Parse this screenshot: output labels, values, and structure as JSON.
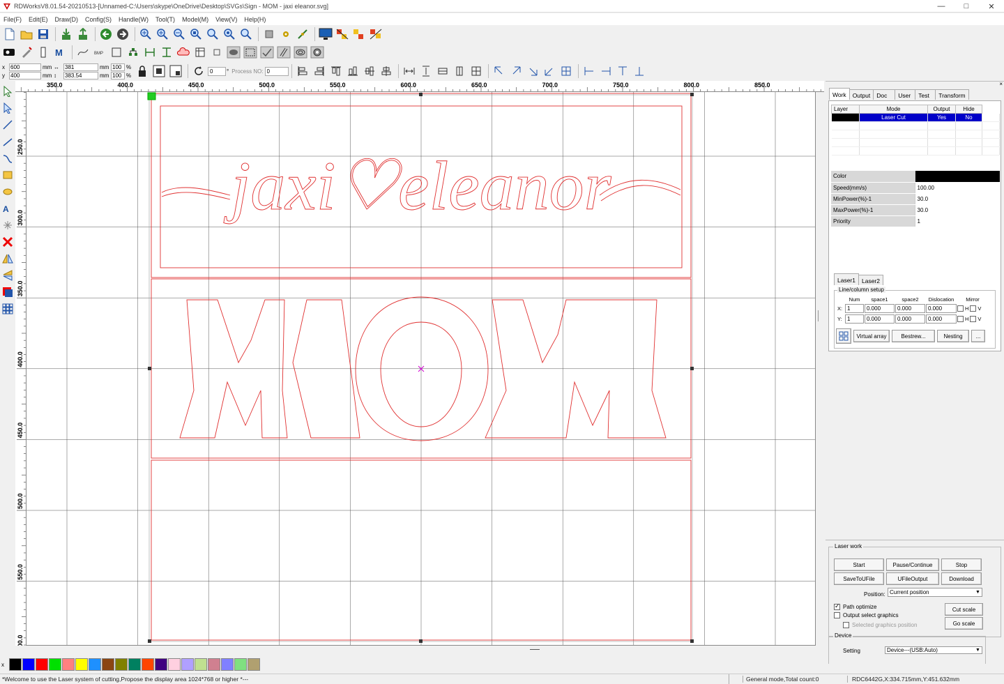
{
  "window": {
    "title": "RDWorksV8.01.54-20210513-[Unnamed-C:\\Users\\skype\\OneDrive\\Desktop\\SVGs\\Sign - MOM - jaxi eleanor.svg]",
    "minimize": "—",
    "maximize": "□",
    "close": "✕"
  },
  "menu": [
    "File(F)",
    "Edit(E)",
    "Draw(D)",
    "Config(S)",
    "Handle(W)",
    "Tool(T)",
    "Model(M)",
    "View(V)",
    "Help(H)"
  ],
  "coords": {
    "x_label": "x",
    "y_label": "y",
    "x_value": "600",
    "y_value": "400",
    "unit": "mm",
    "width_value": "381",
    "height_value": "383.54",
    "scale_x": "100",
    "scale_y": "100",
    "percent": "%",
    "rotate_value": "0",
    "degree": "°",
    "process_label": "Process NO:",
    "process_value": "0"
  },
  "ruler": {
    "top_labels": [
      "350.0",
      "400.0",
      "450.0",
      "500.0",
      "550.0",
      "600.0",
      "650.0",
      "700.0",
      "750.0",
      "800.0",
      "850.0"
    ],
    "left_labels": [
      "250.0",
      "300.0",
      "350.0",
      "400.0",
      "450.0",
      "500.0",
      "550.0",
      "600.0"
    ]
  },
  "palette": {
    "label": "x",
    "colors": [
      "#000000",
      "#0000ff",
      "#ff0000",
      "#00e000",
      "#ff8080",
      "#ffff00",
      "#1e90ff",
      "#8b4513",
      "#808000",
      "#008060",
      "#ff4500",
      "#400080",
      "#ffd0e0",
      "#b0a0ff",
      "#c0e090",
      "#d08090",
      "#8080ff",
      "#80e080",
      "#b0a070"
    ]
  },
  "status": {
    "message": "*Welcome to use the Laser system of cutting,Propose the display area 1024*768 or higher *---",
    "mode": "General mode,Total count:0",
    "device_pos": "RDC6442G,X:334.715mm,Y:451.632mm"
  },
  "panel": {
    "close": "×",
    "tabs": [
      "Work",
      "Output",
      "Doc",
      "User",
      "Test",
      "Transform"
    ],
    "layer_headers": [
      "Layer",
      "Mode",
      "Output",
      "Hide"
    ],
    "layer_rows": [
      {
        "color": "#000000",
        "mode": "Laser Cut",
        "output": "Yes",
        "hide": "No"
      }
    ],
    "props": [
      {
        "key": "Color",
        "value": ""
      },
      {
        "key": "Speed(mm/s)",
        "value": "100.00"
      },
      {
        "key": "MinPower(%)-1",
        "value": "30.0"
      },
      {
        "key": "MaxPower(%)-1",
        "value": "30.0"
      },
      {
        "key": "Priority",
        "value": "1"
      }
    ],
    "laser_tabs": [
      "Laser1",
      "Laser2"
    ],
    "line_column": {
      "title": "Line/column setup",
      "headers": [
        "Num",
        "space1",
        "space2",
        "Dislocation",
        "Mirror"
      ],
      "x_label": "X:",
      "y_label": "Y:",
      "x_num": "1",
      "x_space1": "0.000",
      "x_space2": "0.000",
      "x_disloc": "0.000",
      "y_num": "1",
      "y_space1": "0.000",
      "y_space2": "0.000",
      "y_disloc": "0.000",
      "h": "H",
      "v": "V",
      "virtual_array": "Virtual array",
      "bestrew": "Bestrew...",
      "nesting": "Nesting",
      "more": "..."
    },
    "laser_work": {
      "title": "Laser work",
      "start": "Start",
      "pause": "Pause/Continue",
      "stop": "Stop",
      "save_u": "SaveToUFile",
      "ufile_output": "UFileOutput",
      "download": "Download",
      "position_label": "Position:",
      "position_value": "Current position",
      "path_optimize": "Path optimize",
      "path_optimize_checked": true,
      "output_select": "Output select graphics",
      "output_select_checked": false,
      "selected_pos": "Selected graphics position",
      "selected_pos_checked": false,
      "cut_scale": "Cut scale",
      "go_scale": "Go scale"
    },
    "device": {
      "title": "Device",
      "setting": "Setting",
      "device_value": "Device---(USB:Auto)"
    }
  },
  "design": {
    "script_text": "jaxi♡eleanor",
    "big_text": "MOM"
  }
}
